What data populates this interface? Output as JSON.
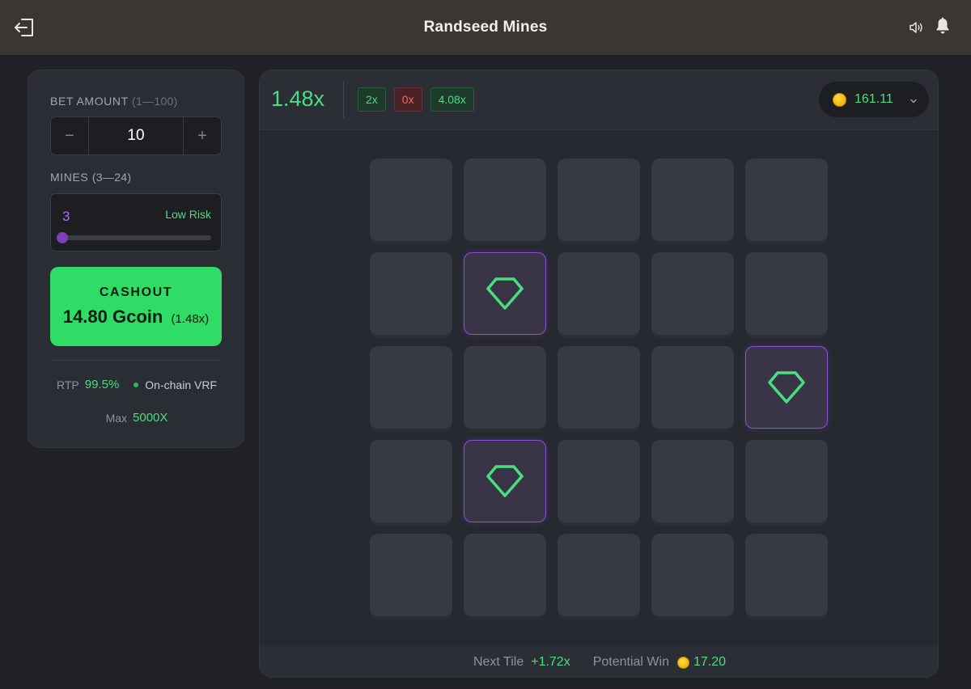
{
  "header": {
    "title": "Randseed Mines",
    "exit_icon": "exit-icon",
    "sound_icon": "speaker-icon",
    "notification_icon": "bell-icon"
  },
  "bet": {
    "label": "BET AMOUNT",
    "range": "(1—100)",
    "decrement": "−",
    "value": "10",
    "increment": "+"
  },
  "mines": {
    "label": "MINES",
    "range": "(3—24)",
    "count": "3",
    "risk": "Low Risk",
    "slider_fraction": 0
  },
  "cashout": {
    "label": "CASHOUT",
    "amount": "14.80 Gcoin",
    "multiplier": "(1.48x)"
  },
  "stats": {
    "rtp_label": "RTP",
    "rtp_value": "99.5%",
    "vrf": "On-chain VRF",
    "max_label": "Max",
    "max_value": "5000X"
  },
  "game": {
    "current_multiplier": "1.48x",
    "history": [
      {
        "label": "2x",
        "type": "win"
      },
      {
        "label": "0x",
        "type": "loss"
      },
      {
        "label": "4.08x",
        "type": "win"
      }
    ],
    "balance": "161.11",
    "grid": [
      [
        "hidden",
        "hidden",
        "hidden",
        "hidden",
        "hidden"
      ],
      [
        "hidden",
        "gem",
        "hidden",
        "hidden",
        "hidden"
      ],
      [
        "hidden",
        "hidden",
        "hidden",
        "hidden",
        "gem"
      ],
      [
        "hidden",
        "gem",
        "hidden",
        "hidden",
        "hidden"
      ],
      [
        "hidden",
        "hidden",
        "hidden",
        "hidden",
        "hidden"
      ]
    ],
    "next_tile_label": "Next Tile",
    "next_tile_value": "+1.72x",
    "potential_win_label": "Potential Win",
    "potential_win_value": "17.20"
  },
  "colors": {
    "accent_green": "#4ade80",
    "cashout_green": "#2edc66",
    "gem_border": "#8b52d4",
    "loss_red": "#f06a6a"
  }
}
